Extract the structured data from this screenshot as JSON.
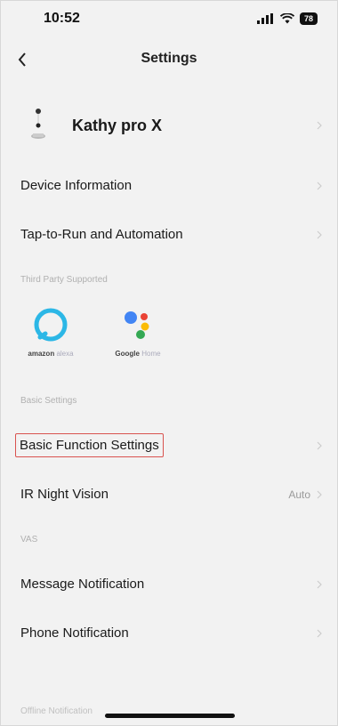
{
  "status_bar": {
    "time": "10:52",
    "battery": "78"
  },
  "nav": {
    "title": "Settings"
  },
  "device": {
    "name": "Kathy pro X"
  },
  "rows_top": [
    {
      "label": "Device Information"
    },
    {
      "label": "Tap-to-Run and Automation"
    }
  ],
  "third_party": {
    "header": "Third Party Supported",
    "items": [
      {
        "label_main": "amazon",
        "label_faint": "alexa",
        "icon": "alexa-icon"
      },
      {
        "label_main": "Google",
        "label_faint": "Home",
        "icon": "google-assistant-icon"
      }
    ]
  },
  "basic_settings": {
    "header": "Basic Settings",
    "function_settings": "Basic Function Settings",
    "ir_night_vision": {
      "label": "IR Night Vision",
      "value": "Auto"
    }
  },
  "vas": {
    "header": "VAS",
    "message_notification": "Message Notification",
    "phone_notification": "Phone Notification"
  },
  "offline": {
    "header": "Offline Notification"
  },
  "colors": {
    "highlight": "#d9534f",
    "background": "#f2f2f2"
  }
}
